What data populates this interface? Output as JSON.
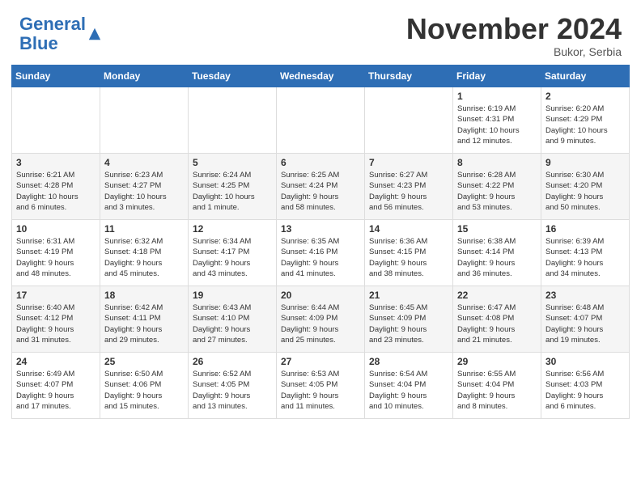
{
  "header": {
    "logo_general": "General",
    "logo_blue": "Blue",
    "month": "November 2024",
    "location": "Bukor, Serbia"
  },
  "days_of_week": [
    "Sunday",
    "Monday",
    "Tuesday",
    "Wednesday",
    "Thursday",
    "Friday",
    "Saturday"
  ],
  "weeks": [
    [
      {
        "day": "",
        "info": ""
      },
      {
        "day": "",
        "info": ""
      },
      {
        "day": "",
        "info": ""
      },
      {
        "day": "",
        "info": ""
      },
      {
        "day": "",
        "info": ""
      },
      {
        "day": "1",
        "info": "Sunrise: 6:19 AM\nSunset: 4:31 PM\nDaylight: 10 hours\nand 12 minutes."
      },
      {
        "day": "2",
        "info": "Sunrise: 6:20 AM\nSunset: 4:29 PM\nDaylight: 10 hours\nand 9 minutes."
      }
    ],
    [
      {
        "day": "3",
        "info": "Sunrise: 6:21 AM\nSunset: 4:28 PM\nDaylight: 10 hours\nand 6 minutes."
      },
      {
        "day": "4",
        "info": "Sunrise: 6:23 AM\nSunset: 4:27 PM\nDaylight: 10 hours\nand 3 minutes."
      },
      {
        "day": "5",
        "info": "Sunrise: 6:24 AM\nSunset: 4:25 PM\nDaylight: 10 hours\nand 1 minute."
      },
      {
        "day": "6",
        "info": "Sunrise: 6:25 AM\nSunset: 4:24 PM\nDaylight: 9 hours\nand 58 minutes."
      },
      {
        "day": "7",
        "info": "Sunrise: 6:27 AM\nSunset: 4:23 PM\nDaylight: 9 hours\nand 56 minutes."
      },
      {
        "day": "8",
        "info": "Sunrise: 6:28 AM\nSunset: 4:22 PM\nDaylight: 9 hours\nand 53 minutes."
      },
      {
        "day": "9",
        "info": "Sunrise: 6:30 AM\nSunset: 4:20 PM\nDaylight: 9 hours\nand 50 minutes."
      }
    ],
    [
      {
        "day": "10",
        "info": "Sunrise: 6:31 AM\nSunset: 4:19 PM\nDaylight: 9 hours\nand 48 minutes."
      },
      {
        "day": "11",
        "info": "Sunrise: 6:32 AM\nSunset: 4:18 PM\nDaylight: 9 hours\nand 45 minutes."
      },
      {
        "day": "12",
        "info": "Sunrise: 6:34 AM\nSunset: 4:17 PM\nDaylight: 9 hours\nand 43 minutes."
      },
      {
        "day": "13",
        "info": "Sunrise: 6:35 AM\nSunset: 4:16 PM\nDaylight: 9 hours\nand 41 minutes."
      },
      {
        "day": "14",
        "info": "Sunrise: 6:36 AM\nSunset: 4:15 PM\nDaylight: 9 hours\nand 38 minutes."
      },
      {
        "day": "15",
        "info": "Sunrise: 6:38 AM\nSunset: 4:14 PM\nDaylight: 9 hours\nand 36 minutes."
      },
      {
        "day": "16",
        "info": "Sunrise: 6:39 AM\nSunset: 4:13 PM\nDaylight: 9 hours\nand 34 minutes."
      }
    ],
    [
      {
        "day": "17",
        "info": "Sunrise: 6:40 AM\nSunset: 4:12 PM\nDaylight: 9 hours\nand 31 minutes."
      },
      {
        "day": "18",
        "info": "Sunrise: 6:42 AM\nSunset: 4:11 PM\nDaylight: 9 hours\nand 29 minutes."
      },
      {
        "day": "19",
        "info": "Sunrise: 6:43 AM\nSunset: 4:10 PM\nDaylight: 9 hours\nand 27 minutes."
      },
      {
        "day": "20",
        "info": "Sunrise: 6:44 AM\nSunset: 4:09 PM\nDaylight: 9 hours\nand 25 minutes."
      },
      {
        "day": "21",
        "info": "Sunrise: 6:45 AM\nSunset: 4:09 PM\nDaylight: 9 hours\nand 23 minutes."
      },
      {
        "day": "22",
        "info": "Sunrise: 6:47 AM\nSunset: 4:08 PM\nDaylight: 9 hours\nand 21 minutes."
      },
      {
        "day": "23",
        "info": "Sunrise: 6:48 AM\nSunset: 4:07 PM\nDaylight: 9 hours\nand 19 minutes."
      }
    ],
    [
      {
        "day": "24",
        "info": "Sunrise: 6:49 AM\nSunset: 4:07 PM\nDaylight: 9 hours\nand 17 minutes."
      },
      {
        "day": "25",
        "info": "Sunrise: 6:50 AM\nSunset: 4:06 PM\nDaylight: 9 hours\nand 15 minutes."
      },
      {
        "day": "26",
        "info": "Sunrise: 6:52 AM\nSunset: 4:05 PM\nDaylight: 9 hours\nand 13 minutes."
      },
      {
        "day": "27",
        "info": "Sunrise: 6:53 AM\nSunset: 4:05 PM\nDaylight: 9 hours\nand 11 minutes."
      },
      {
        "day": "28",
        "info": "Sunrise: 6:54 AM\nSunset: 4:04 PM\nDaylight: 9 hours\nand 10 minutes."
      },
      {
        "day": "29",
        "info": "Sunrise: 6:55 AM\nSunset: 4:04 PM\nDaylight: 9 hours\nand 8 minutes."
      },
      {
        "day": "30",
        "info": "Sunrise: 6:56 AM\nSunset: 4:03 PM\nDaylight: 9 hours\nand 6 minutes."
      }
    ]
  ]
}
